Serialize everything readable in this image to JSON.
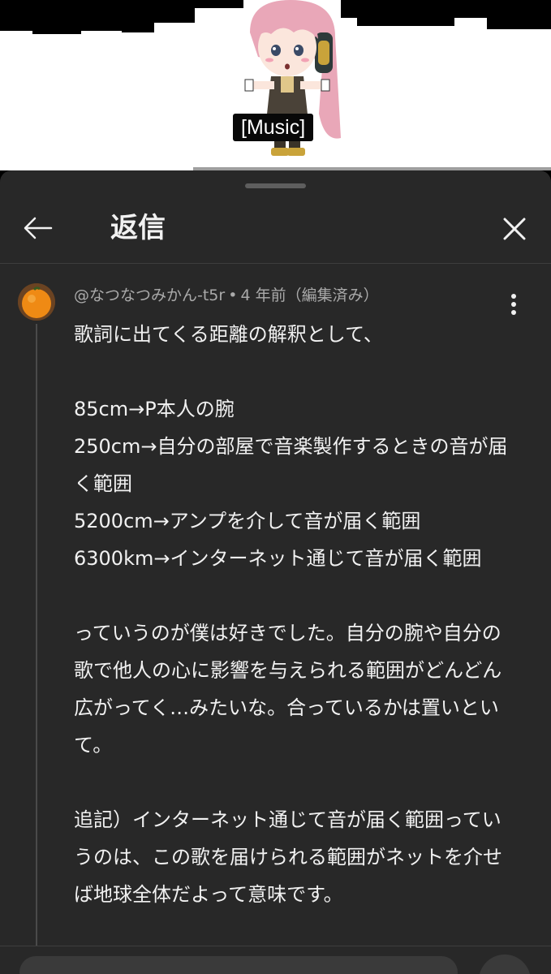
{
  "video": {
    "caption": "[Music]",
    "progress_percent": 35
  },
  "panel": {
    "title": "返信"
  },
  "comment": {
    "author": "@なつなつみかん-t5r",
    "separator": "•",
    "time": "4 年前（編集済み）",
    "lines": [
      "歌詞に出てくる距離の解釈として、",
      "",
      "85cm→P本人の腕",
      "250cm→自分の部屋で音楽製作するときの音が届く範囲",
      "5200cm→アンプを介して音が届く範囲",
      "6300km→インターネット通じて音が届く範囲",
      "",
      "っていうのが僕は好きでした。自分の腕や自分の歌で他人の心に影響を与えられる範囲がどんどん広がってく…みたいな。合っているかは置いといて。",
      "",
      "追記）インターネット通じて音が届く範囲っていうのは、この歌を届けられる範囲がネットを介せば地球全体だよって意味です。"
    ]
  },
  "icons": {
    "back": "arrow-left-icon",
    "close": "close-icon",
    "more": "more-vertical-icon"
  },
  "colors": {
    "sheet_bg": "#282828",
    "text": "#f1f1f1",
    "meta_text": "#aaaaaa"
  }
}
